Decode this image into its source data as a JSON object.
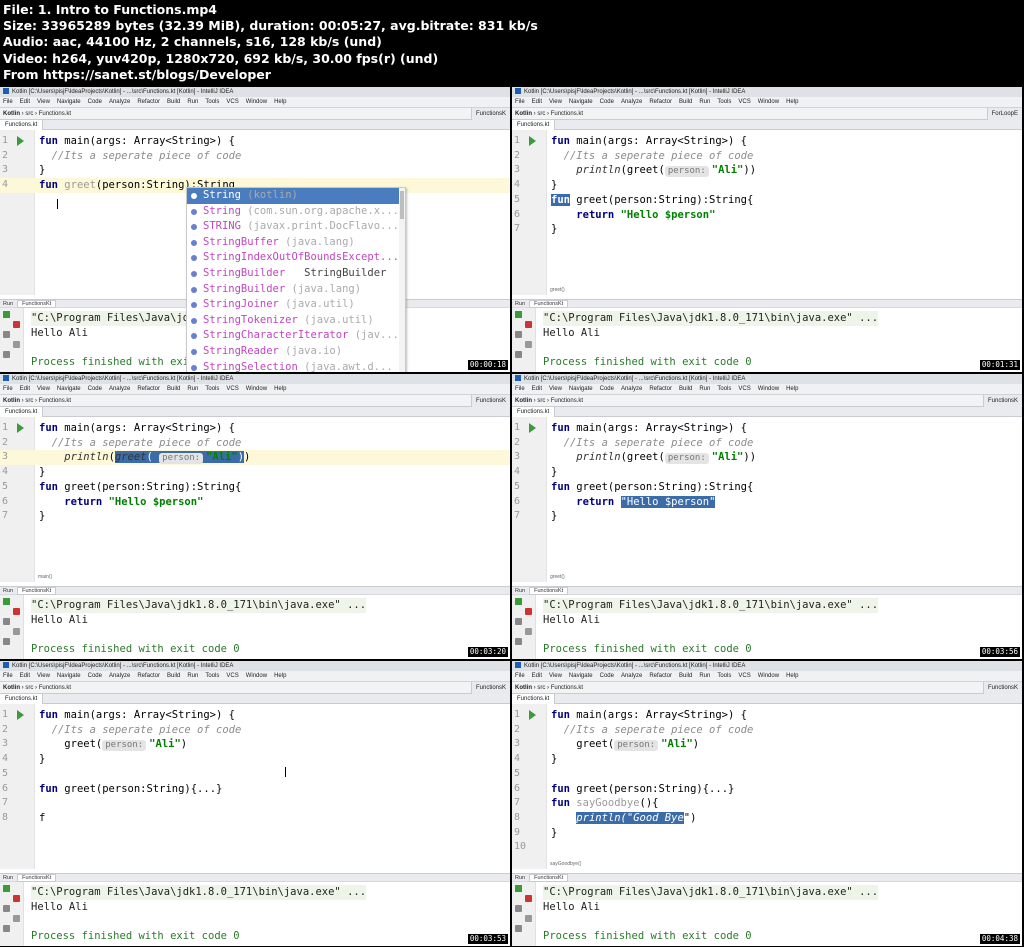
{
  "header": {
    "lines": [
      "File: 1. Intro to Functions.mp4",
      "Size: 33965289 bytes (32.39 MiB), duration: 00:05:27, avg.bitrate: 831 kb/s",
      "Audio: aac, 44100 Hz, 2 channels, s16, 128 kb/s (und)",
      "Video: h264, yuv420p, 1280x720, 692 kb/s, 30.00 fps(r) (und)",
      "From https://sanet.st/blogs/Developer"
    ]
  },
  "ide": {
    "title": "Kotlin [C:\\Users\\pisjF\\IdeaProjects\\Kotlin] - ...\\src\\Functions.kt [Kotlin] - IntelliJ IDEA",
    "menu": [
      "File",
      "Edit",
      "View",
      "Navigate",
      "Code",
      "Analyze",
      "Refactor",
      "Build",
      "Run",
      "Tools",
      "VCS",
      "Window",
      "Help"
    ],
    "breadcrumb": [
      "Kotlin",
      "src",
      "Functions.kt"
    ],
    "file_tab": "Functions.kt",
    "right_tab_a": "ForLoopE",
    "right_tab_b": "FunctionsK",
    "run_label": "Run",
    "run_tab": "FunctionsKt",
    "run_cmd": "\"C:\\Program Files\\Java\\jdk1.8.0_171\\bin\\java.exe\" ...",
    "run_out": "Hello Ali",
    "run_fin": "Process finished with exit code 0"
  },
  "frames": [
    {
      "stamp": "00:00:18",
      "lines": [
        "fun main(args: Array<String>) {",
        "  //Its a seperate piece of code",
        "}",
        "fun greet(person:String):String"
      ],
      "popup": [
        {
          "name": "String",
          "pkg": "(kotlin)"
        },
        {
          "name": "String",
          "pkg": "(com.sun.org.apache.x..."
        },
        {
          "name": "STRING",
          "pkg": "(javax.print.DocFlavo..."
        },
        {
          "name": "StringBuffer",
          "pkg": "(java.lang)"
        },
        {
          "name": "StringIndexOutOfBoundsExcept...",
          "pkg": ""
        },
        {
          "name": "StringBuilder",
          "pkg": "",
          "cls": "StringBuilder"
        },
        {
          "name": "StringBuilder",
          "pkg": "(java.lang)"
        },
        {
          "name": "StringJoiner",
          "pkg": "(java.util)"
        },
        {
          "name": "StringTokenizer",
          "pkg": "(java.util)"
        },
        {
          "name": "StringCharacterIterator",
          "pkg": "(jav..."
        },
        {
          "name": "StringReader",
          "pkg": "(java.io)"
        },
        {
          "name": "StringSelection",
          "pkg": "(java.awt.d..."
        }
      ]
    },
    {
      "stamp": "00:01:31",
      "crumb": "greet()",
      "lines": [
        "fun main(args: Array<String>) {",
        "  //Its a seperate piece of code",
        "    println(greet( person: \"Ali\"))",
        "}",
        "fun greet(person:String):String{",
        "    return \"Hello $person\"",
        "}"
      ]
    },
    {
      "stamp": "00:03:20",
      "crumb": "main()",
      "lines": [
        "fun main(args: Array<String>) {",
        "  //Its a seperate piece of code",
        "    println(greet( person: \"Ali\"))",
        "}",
        "fun greet(person:String):String{",
        "    return \"Hello $person\"",
        "}"
      ]
    },
    {
      "stamp": "00:03:56",
      "crumb": "greet()",
      "lines": [
        "fun main(args: Array<String>) {",
        "  //Its a seperate piece of code",
        "    println(greet( person: \"Ali\"))",
        "}",
        "fun greet(person:String):String{",
        "    return \"Hello $person\"",
        "}"
      ]
    },
    {
      "stamp": "00:03:53",
      "lines": [
        "fun main(args: Array<String>) {",
        "  //Its a seperate piece of code",
        "    greet( person: \"Ali\")",
        "}",
        "fun greet(person:String){...}",
        "f"
      ]
    },
    {
      "stamp": "00:04:38",
      "crumb": "sayGoodbye()",
      "lines": [
        "fun main(args: Array<String>) {",
        "  //Its a seperate piece of code",
        "    greet( person: \"Ali\")",
        "}",
        "fun greet(person:String){...}",
        "fun sayGoodbye(){",
        "    println(\"Good Bye\")",
        "}"
      ]
    }
  ]
}
